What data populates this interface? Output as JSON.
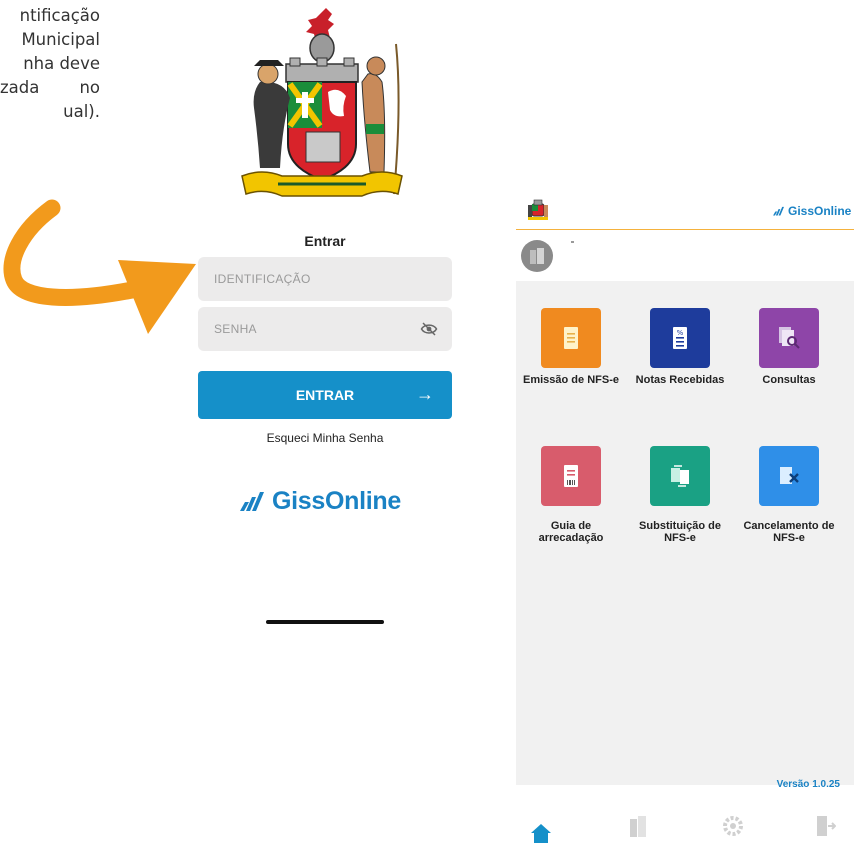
{
  "left_text": {
    "line1": "ntificação",
    "line2": "Municipal",
    "line3": "nha deve",
    "line4_a": "zada",
    "line4_b": "no",
    "line5": "ual)."
  },
  "login": {
    "title": "Entrar",
    "id_placeholder": "IDENTIFICAÇÃO",
    "password_placeholder": "SENHA",
    "enter_label": "ENTRAR",
    "enter_arrow": "→",
    "forgot_label": "Esqueci Minha Senha",
    "brand": "GissOnline"
  },
  "app": {
    "brand": "GissOnline",
    "menu": [
      {
        "label": "Emissão de NFS-e",
        "color": "#f08a1f",
        "icon": "document-icon"
      },
      {
        "label": "Notas Recebidas",
        "color": "#1e3c9c",
        "icon": "received-notes-icon"
      },
      {
        "label": "Consultas",
        "color": "#8e45a8",
        "icon": "search-documents-icon"
      },
      {
        "label": "Guia de arrecadação",
        "color": "#d85c6c",
        "icon": "payment-slip-icon"
      },
      {
        "label": "Substituição de NFS-e",
        "color": "#1aa184",
        "icon": "replace-document-icon"
      },
      {
        "label": "Cancelamento de NFS-e",
        "color": "#2f8fe8",
        "icon": "cancel-document-icon"
      }
    ],
    "version": "Versão 1.0.25",
    "nav": [
      "home-icon",
      "building-icon",
      "gear-icon",
      "logout-icon"
    ]
  },
  "colors": {
    "primary": "#1590c9",
    "brand_blue": "#1a82c4",
    "arrow_orange": "#f29a1c",
    "accent_line": "#f5b23d"
  }
}
